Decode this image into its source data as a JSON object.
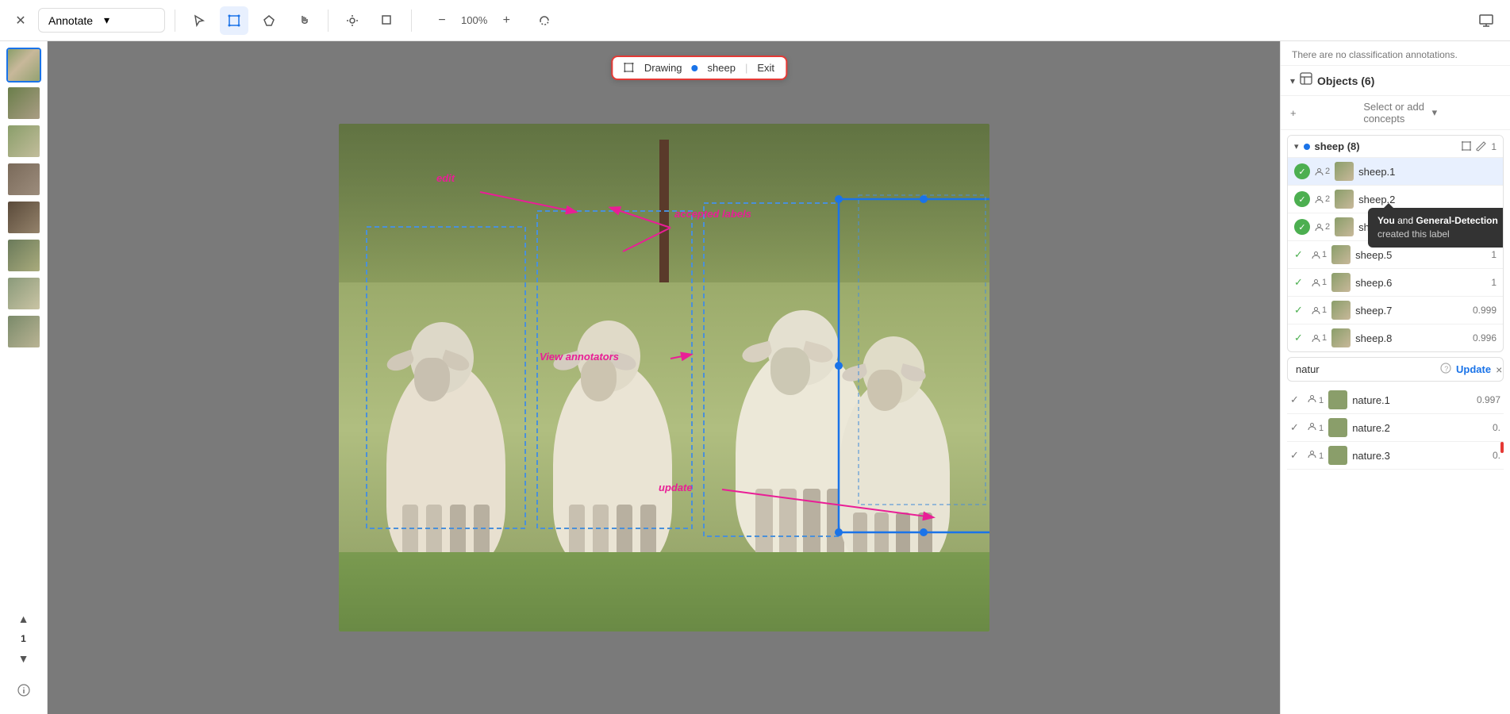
{
  "toolbar": {
    "close_label": "×",
    "annotate_label": "Annotate",
    "zoom_level": "100%",
    "tools": [
      "select",
      "bounding-box",
      "polygon",
      "hand",
      "brightness",
      "crop",
      "route"
    ],
    "zoom_in": "+",
    "zoom_out": "−"
  },
  "drawing_mode": {
    "label": "Drawing",
    "concept": "sheep",
    "exit_label": "Exit"
  },
  "classification_note": "There are no classification annotations.",
  "objects_section": {
    "title": "Objects (6)",
    "add_concepts_placeholder": "Select or add concepts"
  },
  "sheep_group": {
    "label": "sheep (8)",
    "count": "1",
    "items": [
      {
        "id": "sheep.1",
        "annotators": "2",
        "score": "",
        "accepted": true,
        "green": true
      },
      {
        "id": "sheep.2",
        "annotators": "2",
        "score": "",
        "accepted": true,
        "green": true
      },
      {
        "id": "sheep.4",
        "annotators": "2",
        "score": "",
        "accepted": true,
        "green": true
      },
      {
        "id": "sheep.5",
        "annotators": "1",
        "score": "1",
        "accepted": true,
        "green": false
      },
      {
        "id": "sheep.6",
        "annotators": "1",
        "score": "1",
        "accepted": true,
        "green": false
      },
      {
        "id": "sheep.7",
        "annotators": "1",
        "score": "0.999",
        "accepted": true,
        "green": false
      },
      {
        "id": "sheep.8",
        "annotators": "1",
        "score": "0.996",
        "accepted": true,
        "green": false
      }
    ]
  },
  "tooltip": {
    "you_label": "You",
    "and_label": " and ",
    "general_label": "General-Detection",
    "created_label": "created this label"
  },
  "update_bar": {
    "value": "natur",
    "update_label": "Update",
    "close_label": "×"
  },
  "nature_items": [
    {
      "id": "nature.1",
      "annotators": "1",
      "score": "0.997"
    },
    {
      "id": "nature.2",
      "annotators": "1",
      "score": "0."
    },
    {
      "id": "nature.3",
      "annotators": "1",
      "score": "0."
    }
  ],
  "canvas_labels": {
    "edit": "edit",
    "accepted_labels": "accepted labels",
    "view_annotators": "View annotators",
    "update": "update"
  },
  "thumbnails": [
    {
      "id": "thumb-1",
      "active": true
    },
    {
      "id": "thumb-2",
      "active": false
    },
    {
      "id": "thumb-3",
      "active": false
    },
    {
      "id": "thumb-4",
      "active": false
    },
    {
      "id": "thumb-5",
      "active": false
    },
    {
      "id": "thumb-6",
      "active": false
    },
    {
      "id": "thumb-7",
      "active": false
    },
    {
      "id": "thumb-8",
      "active": false
    }
  ],
  "page_nav": {
    "up": "▲",
    "page": "1",
    "down": "▼"
  }
}
